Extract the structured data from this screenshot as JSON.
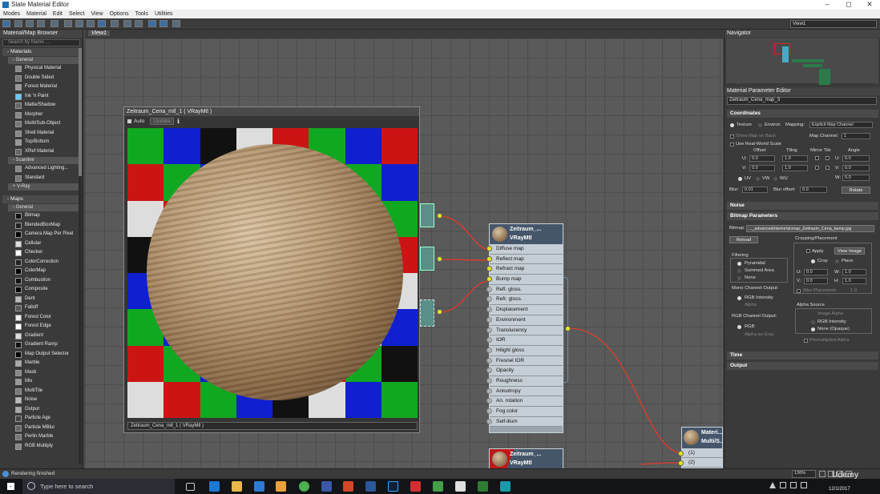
{
  "title": "Slate Material Editor",
  "menu": [
    "Modes",
    "Material",
    "Edit",
    "Select",
    "View",
    "Options",
    "Tools",
    "Utilities"
  ],
  "view_selector": "View1",
  "browser": {
    "title": "Material/Map Browser",
    "search_placeholder": "Search by Name ...",
    "materials_label": "- Materials",
    "general_label": "- General",
    "materials": [
      "Physical Material",
      "Double Sided",
      "Forest Material",
      "Ink 'n Paint",
      "Matte/Shadow",
      "Morpher",
      "Multi/Sub-Object",
      "Shell Material",
      "Top/Bottom",
      "XRef Material"
    ],
    "scanline_label": "- Scanline",
    "scanline": [
      "Advanced Lighting...",
      "Standard"
    ],
    "vray_label": "+ V-Ray",
    "maps_label": "- Maps",
    "maps_general_label": "- General",
    "maps": [
      "Bitmap",
      "BlendedBoxMap",
      "Camera Map Per Pixel",
      "Cellular",
      "Checker",
      "ColorCorrection",
      "ColorMap",
      "Combustion",
      "Composite",
      "Dent",
      "Falloff",
      "Forest Color",
      "Forest Edge",
      "Gradient",
      "Gradient Ramp",
      "Map Output Selector",
      "Marble",
      "Mask",
      "Mix",
      "MultiTile",
      "Noise",
      "Output",
      "Particle Age",
      "Particle MBlur",
      "Perlin Marble",
      "RGB Multiply"
    ]
  },
  "view_tab": "View1",
  "preview": {
    "title": "Zeitraum_Cena_mtl_1  ( VRayMtl )",
    "auto": "Auto",
    "update": "Update",
    "footer": "Zeitraum_Cena_mtl_1  ( VRayMtl )"
  },
  "node_main": {
    "name": "Zeitraum_...",
    "type": "VRayMtl",
    "slots": [
      "Diffuse map",
      "Reflect map",
      "Refract map",
      "Bump map",
      "Refl. gloss.",
      "Refr. gloss.",
      "Displacement",
      "Environment",
      "Translucency",
      "IOR",
      "Hilight gloss",
      "Fresnel IOR",
      "Opacity",
      "Roughness",
      "Anisotropy",
      "An. rotation",
      "Fog color",
      "Self-illum"
    ]
  },
  "node_bottom": {
    "name": "Zeitraum_...",
    "type": "VRayMtl"
  },
  "node_multi": {
    "name": "Materi...",
    "type": "Multi/S...",
    "slots": [
      "(1)",
      "(2)"
    ]
  },
  "navigator": {
    "title": "Navigator"
  },
  "params": {
    "title": "Material Parameter Editor",
    "map_name": "Zeitraum_Cena_map_3",
    "coordinates": "Coordinates",
    "texture": "Texture",
    "environ": "Environ",
    "mapping_label": "Mapping:",
    "mapping_value": "Explicit Map Channel",
    "show_map": "Show Map on Back",
    "map_channel_label": "Map Channel:",
    "map_channel": "1",
    "real_world": "Use Real-World Scale",
    "offset": "Offset",
    "tiling": "Tiling",
    "mirror_tile": "Mirror Tile",
    "angle": "Angle",
    "u_label": "U:",
    "v_label": "V:",
    "w_label": "W:",
    "u_offset": "0.0",
    "v_offset": "0.0",
    "u_tiling": "1.0",
    "v_tiling": "1.0",
    "u_angle": "0.0",
    "v_angle": "0.0",
    "w_angle": "0.0",
    "uv": "UV",
    "vw": "VW",
    "wu": "WU",
    "blur_label": "Blur:",
    "blur": "0.01",
    "blur_offset_label": "Blur offset:",
    "blur_offset": "0.0",
    "rotate": "Rotate",
    "noise": "Noise",
    "bitmap_params": "Bitmap Parameters",
    "bitmap_label": "Bitmap:",
    "bitmap_path": "..._advancedInterior\\dcmap_Zeitraum_Cena_bump.jpg",
    "reload": "Reload",
    "cropping": "Cropping/Placement",
    "apply": "Apply",
    "view_image": "View Image",
    "crop": "Crop",
    "place": "Place",
    "crop_u": "0.0",
    "crop_v": "0.0",
    "crop_w": "1.0",
    "crop_h": "1.0",
    "h_label": "H:",
    "jitter": "Jitter Placement:",
    "jitter_value": "1.0",
    "filtering": "Filtering",
    "pyramidal": "Pyramidal",
    "summed": "Summed Area",
    "none": "None",
    "mono_output": "Mono Channel Output:",
    "rgb_intensity": "RGB Intensity",
    "alpha": "Alpha",
    "rgb_output": "RGB Channel Output:",
    "rgb": "RGB",
    "alpha_grey": "Alpha as Gray",
    "alpha_source": "Alpha Source",
    "image_alpha": "Image Alpha",
    "rgb_intensity2": "RGB Intensity",
    "none_opaque": "None (Opaque)",
    "premult": "Premultiplied Alpha",
    "time": "Time",
    "output": "Output"
  },
  "status": {
    "text": "Rendering finished",
    "zoom": "136%"
  },
  "taskbar": {
    "search": "Type here to search",
    "time": "12/1/2017",
    "watermark": "Udemy"
  },
  "colors": {
    "slot_bg": "#c5ced5",
    "node_head": "#45566a",
    "wire": "#e23b2a",
    "socket": "#e6e61e"
  }
}
